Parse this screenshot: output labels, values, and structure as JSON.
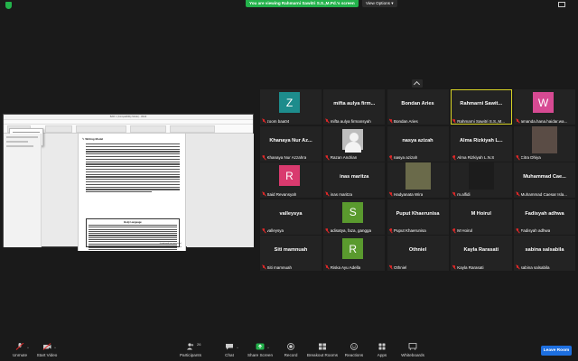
{
  "banner": {
    "sharing_text": "You are viewing Rahmarni Sawitri S.S.,M.Pd.'s screen",
    "view_options": "View Options ▾"
  },
  "shared_doc": {
    "window_title": "BAR 1 (Compatibility Mode) - Word",
    "heading": "✎ Writing Model",
    "box_title": "Body Language",
    "continue_note": "(continued on next page)",
    "footer": "Writer Statement"
  },
  "participants": [
    {
      "big": "Z",
      "name": "zoom baa04",
      "color": "#1d8c8c",
      "type": "avatar"
    },
    {
      "big": "mifta aulya firm...",
      "name": "mifta aulya firmansyah",
      "type": "text"
    },
    {
      "big": "Bondan Aries",
      "name": "Bondan Aries",
      "type": "text"
    },
    {
      "big": "Rahmarni Sawit...",
      "name": "Rahmarni Sawitri S.S.,M...",
      "type": "text",
      "speaking": true
    },
    {
      "big": "W",
      "name": "amanda.hana.haidar.wa...",
      "color": "#d74a93",
      "type": "avatar"
    },
    {
      "big": "Khanaya Nur Az...",
      "name": "Khanaya Nur Azzahra",
      "type": "text"
    },
    {
      "big": "",
      "name": "Razan Andrian",
      "type": "photo-gray"
    },
    {
      "big": "nasya azizah",
      "name": "nasya azizah",
      "type": "text"
    },
    {
      "big": "Alma Rizkiyah L...",
      "name": "Alma Rizkiyah L.N.S",
      "type": "text"
    },
    {
      "big": "",
      "name": "Citra Dhiya",
      "type": "video"
    },
    {
      "big": "R",
      "name": "Said Revansyah",
      "color": "#d93a6e",
      "type": "avatar"
    },
    {
      "big": "inas maritza",
      "name": "inas maritza",
      "type": "text"
    },
    {
      "big": "",
      "name": "Hadyanata Wira",
      "type": "video"
    },
    {
      "big": "",
      "name": "m.alfidi",
      "type": "video"
    },
    {
      "big": "Muhammad Cae...",
      "name": "Muhammad Caesar Isla...",
      "type": "text"
    },
    {
      "big": "valleysya",
      "name": "valleysya",
      "type": "text"
    },
    {
      "big": "S",
      "name": "adisatya, faza, gangga",
      "color": "#5a9a2e",
      "type": "avatar"
    },
    {
      "big": "Puput Khaerunisa",
      "name": "Puput Khaerunisa",
      "type": "text"
    },
    {
      "big": "M Hoirul",
      "name": "M Hoirul",
      "type": "text"
    },
    {
      "big": "Fadisyah adhwa",
      "name": "Fadisyah adhwa",
      "type": "text"
    },
    {
      "big": "Siti mamnuah",
      "name": "Siti mamnuah",
      "type": "text"
    },
    {
      "big": "R",
      "name": "Riska Ayu Adella",
      "color": "#5a9a2e",
      "type": "avatar"
    },
    {
      "big": "Othniel",
      "name": "Othniel",
      "type": "text"
    },
    {
      "big": "Kayla Rarasati",
      "name": "Kayla Rarasati",
      "type": "text"
    },
    {
      "big": "sabina salsabila",
      "name": "sabina salsabila",
      "type": "text"
    }
  ],
  "toolbar": {
    "unmute": "Unmute",
    "start_video": "Start Video",
    "participants": "Participants",
    "participants_count": "26",
    "chat": "Chat",
    "share_screen": "Share Screen",
    "record": "Record",
    "breakout_rooms": "Breakout Rooms",
    "reactions": "Reactions",
    "apps": "Apps",
    "whiteboards": "Whiteboards",
    "leave": "Leave Room"
  }
}
